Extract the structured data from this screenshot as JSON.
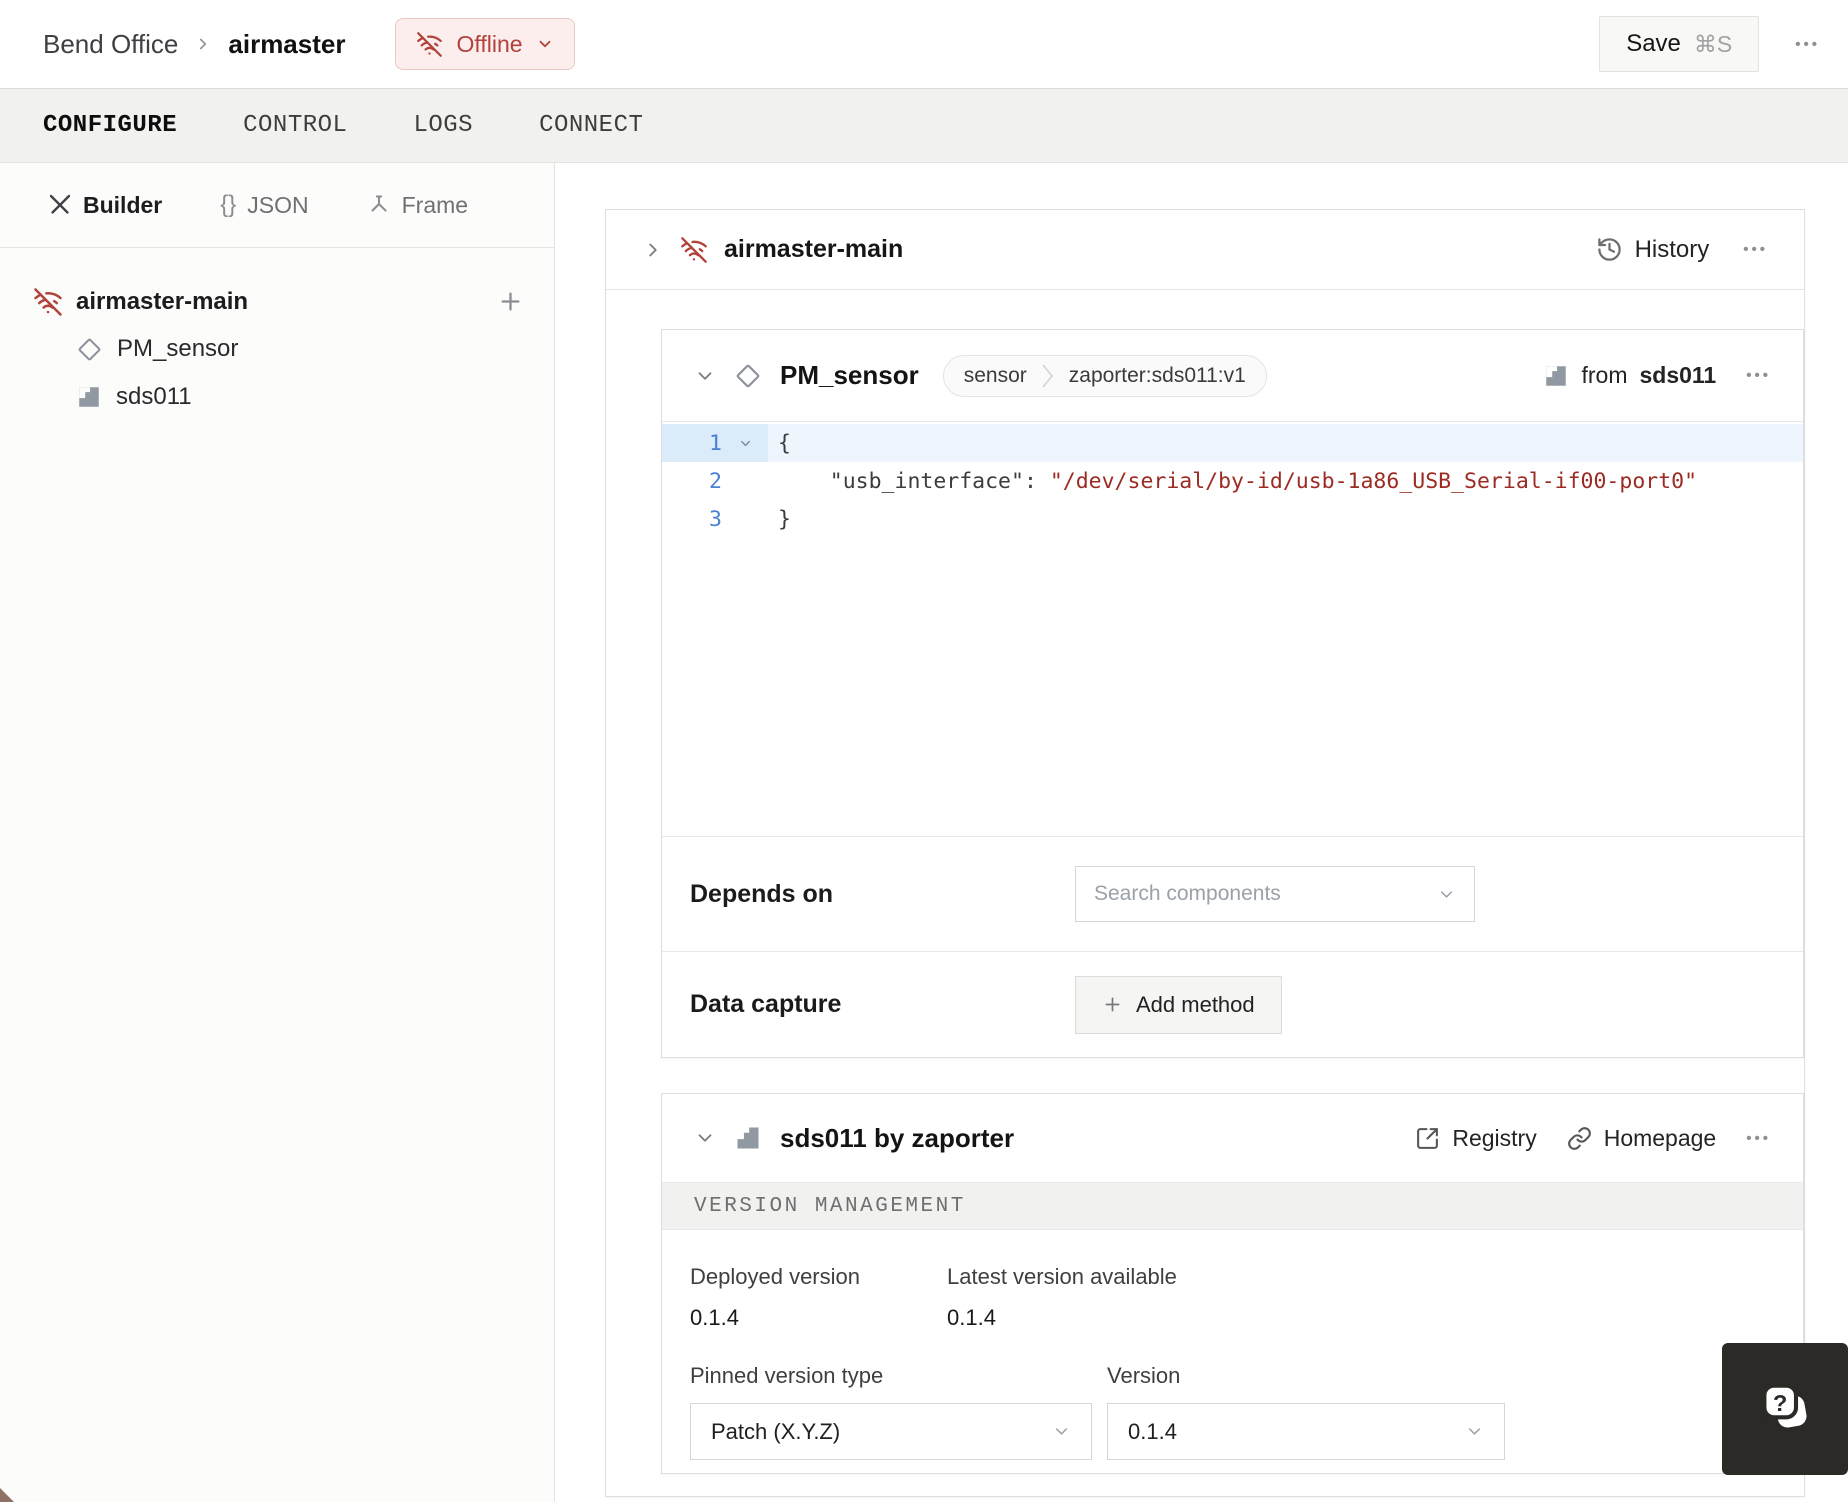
{
  "header": {
    "breadcrumb": {
      "org": "Bend Office",
      "machine": "airmaster"
    },
    "status_badge": {
      "label": "Offline"
    },
    "save_button": {
      "label": "Save",
      "shortcut": "⌘S"
    },
    "overflow_glyph": "•••"
  },
  "tabs": {
    "configure": "CONFIGURE",
    "control": "CONTROL",
    "logs": "LOGS",
    "connect": "CONNECT"
  },
  "sidebar": {
    "modes": {
      "builder": "Builder",
      "json_glyph": "{}",
      "json": "JSON",
      "frame": "Frame"
    },
    "tree": {
      "root": "airmaster-main",
      "component": "PM_sensor",
      "module": "sds011"
    }
  },
  "part": {
    "title": "airmaster-main",
    "history_label": "History",
    "menu_glyph": "•••"
  },
  "component": {
    "title": "PM_sensor",
    "type_badge": "sensor",
    "model_badge": "zaporter:sds011:v1",
    "from_prefix": "from",
    "from_module": "sds011",
    "menu_glyph": "•••",
    "code": {
      "line1": {
        "num": "1",
        "text": "{"
      },
      "line2": {
        "num": "2",
        "key": "    \"usb_interface\":",
        "value": " \"/dev/serial/by-id/usb-1a86_USB_Serial-if00-port0\""
      },
      "line3": {
        "num": "3",
        "text": "}"
      }
    },
    "depends_on": {
      "label": "Depends on",
      "placeholder": "Search components"
    },
    "data_capture": {
      "label": "Data capture",
      "add_button": "Add method"
    }
  },
  "module": {
    "title": "sds011 by zaporter",
    "registry_label": "Registry",
    "homepage_label": "Homepage",
    "menu_glyph": "•••",
    "version_management": {
      "section_title": "VERSION MANAGEMENT",
      "deployed_label": "Deployed version",
      "deployed_value": "0.1.4",
      "latest_label": "Latest version available",
      "latest_value": "0.1.4",
      "pinned_label": "Pinned version type",
      "pinned_value": "Patch (X.Y.Z)",
      "version_label": "Version",
      "version_value": "0.1.4"
    }
  },
  "colors": {
    "offline_red": "#b2423a",
    "offline_bg": "#fbeeec",
    "line_number_blue": "#4a7fd4",
    "code_value_red": "#9c2b23",
    "tabbar_bg": "#f1f1ef",
    "border": "#dfdfdf"
  }
}
